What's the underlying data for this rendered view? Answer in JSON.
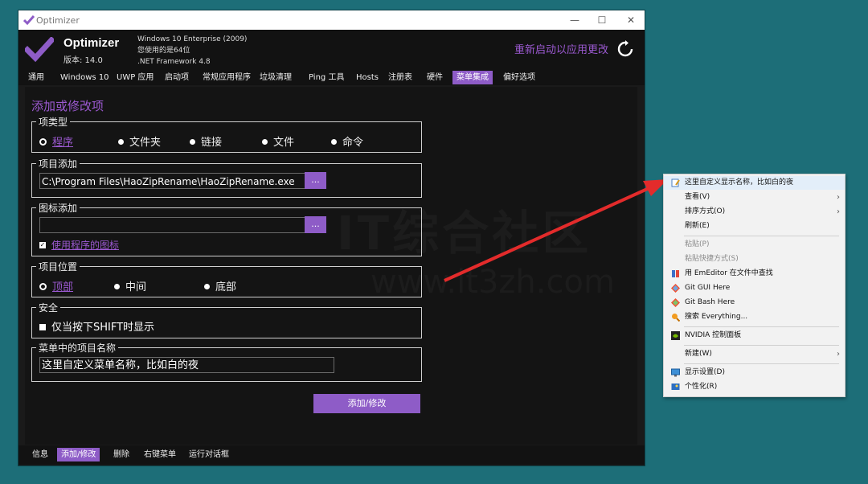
{
  "window": {
    "title": "Optimizer",
    "app_name": "Optimizer",
    "version": "版本: 14.0",
    "sys_info": [
      "Windows 10 Enterprise (2009)",
      "您使用的是64位",
      ".NET Framework 4.8"
    ],
    "restart_label": "重新启动以应用更改",
    "controls": {
      "minimize": "—",
      "maximize": "☐",
      "close": "✕"
    }
  },
  "tabs": [
    "通用",
    "Windows 10",
    "UWP 应用",
    "启动项",
    "常规应用程序",
    "垃圾清理",
    "Ping 工具",
    "Hosts",
    "注册表",
    "硬件",
    "菜单集成",
    "偏好选项"
  ],
  "active_tab": "菜单集成",
  "form": {
    "section_title": "添加或修改项",
    "item_type": {
      "legend": "项类型",
      "options": [
        "程序",
        "文件夹",
        "链接",
        "文件",
        "命令"
      ],
      "selected": "程序"
    },
    "item_add": {
      "legend": "项目添加",
      "value": "C:\\Program Files\\HaoZipRename\\HaoZipRename.exe",
      "browse_label": "..."
    },
    "icon_add": {
      "legend": "图标添加",
      "value": "",
      "browse_label": "...",
      "use_program_icon": "使用程序的图标"
    },
    "position": {
      "legend": "项目位置",
      "options": [
        "顶部",
        "中间",
        "底部"
      ],
      "selected": "顶部"
    },
    "security": {
      "legend": "安全",
      "shift_only": "仅当按下SHIFT时显示"
    },
    "menu_name": {
      "legend": "菜单中的项目名称",
      "value": "这里自定义菜单名称，比如白的夜"
    },
    "submit_label": "添加/修改"
  },
  "bottom_tabs": [
    "信息",
    "添加/修改",
    "删除",
    "右键菜单",
    "运行对话框"
  ],
  "active_bottom_tab": "添加/修改",
  "watermark": {
    "line1": "IT综合社区",
    "line2": "www.it3zh.com"
  },
  "context_menu": {
    "items": [
      {
        "label": "这里自定义显示名称，比如白的夜",
        "icon": "editor-icon"
      },
      {
        "label": "查看(V)",
        "submenu": true
      },
      {
        "label": "排序方式(O)",
        "submenu": true
      },
      {
        "label": "刷新(E)"
      },
      {
        "label": "粘贴(P)",
        "disabled": true
      },
      {
        "label": "粘贴快捷方式(S)",
        "disabled": true
      },
      {
        "label": "用 EmEditor 在文件中查找",
        "icon": "emeditor-icon"
      },
      {
        "label": "Git GUI Here",
        "icon": "git-icon"
      },
      {
        "label": "Git Bash Here",
        "icon": "git-icon"
      },
      {
        "label": "搜索 Everything...",
        "icon": "search-everything-icon"
      },
      {
        "label": "NVIDIA 控制面板",
        "icon": "nvidia-icon"
      },
      {
        "label": "新建(W)",
        "submenu": true
      },
      {
        "label": "显示设置(D)",
        "icon": "display-icon"
      },
      {
        "label": "个性化(R)",
        "icon": "personalize-icon"
      }
    ]
  },
  "colors": {
    "accent": "#8e5cc7",
    "accent_text": "#9b59d0",
    "desktop": "#1d6e78",
    "annotation_arrow": "#e32b2b"
  }
}
